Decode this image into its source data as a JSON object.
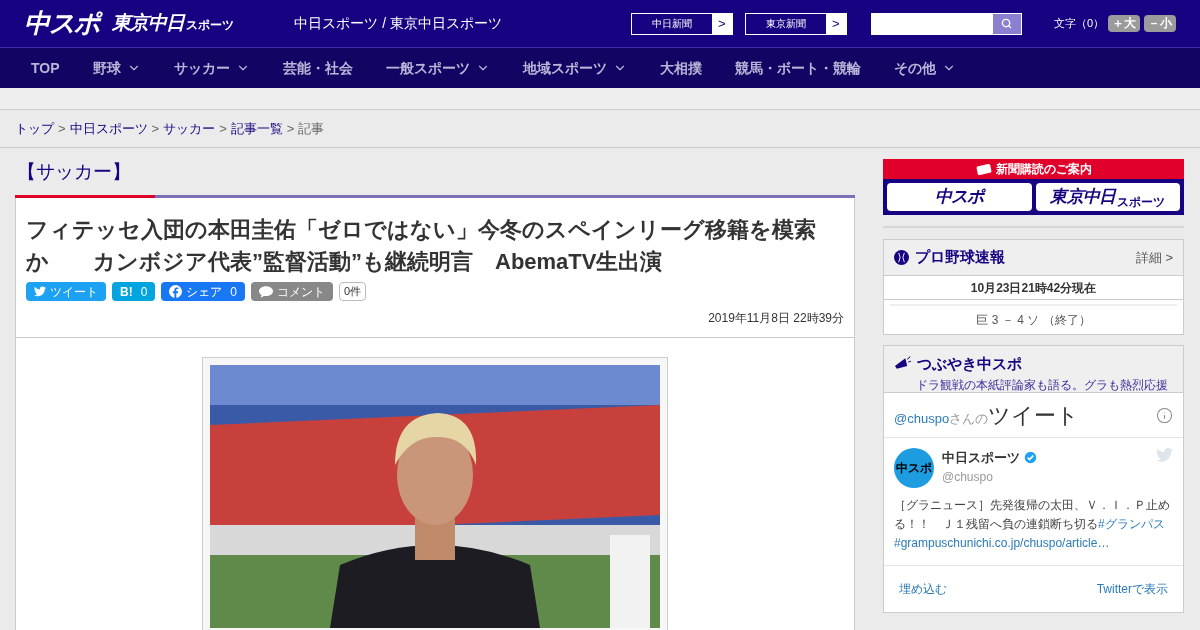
{
  "header": {
    "logo_main": "中スポ",
    "logo_tokyo": "東京中日",
    "logo_tokyo_small": "スポーツ",
    "site_title": "中日スポーツ / 東京中日スポーツ",
    "paper_links": [
      {
        "label": "中日新聞",
        "arrow": ">"
      },
      {
        "label": "東京新聞",
        "arrow": ">"
      }
    ],
    "font_size": {
      "label": "文字（0）",
      "buttons": [
        "＋大",
        "－小"
      ]
    }
  },
  "nav": [
    {
      "label": "TOP",
      "has_menu": false
    },
    {
      "label": "野球",
      "has_menu": true
    },
    {
      "label": "サッカー",
      "has_menu": true
    },
    {
      "label": "芸能・社会",
      "has_menu": false
    },
    {
      "label": "一般スポーツ",
      "has_menu": true
    },
    {
      "label": "地域スポーツ",
      "has_menu": true
    },
    {
      "label": "大相撲",
      "has_menu": false
    },
    {
      "label": "競馬・ボート・競輪",
      "has_menu": false
    },
    {
      "label": "その他",
      "has_menu": true
    }
  ],
  "breadcrumb": {
    "separator": ">",
    "items": [
      {
        "label": "トップ",
        "link": true
      },
      {
        "label": "中日スポーツ",
        "link": true
      },
      {
        "label": "サッカー",
        "link": true
      },
      {
        "label": "記事一覧",
        "link": true
      },
      {
        "label": "記事",
        "link": false
      }
    ]
  },
  "article": {
    "category": "【サッカー】",
    "title": "フィテッセ入団の本田圭佑「ゼロではない」今冬のスペインリーグ移籍を模索か　　カンボジア代表”監督活動”も継続明言　AbemaTV生出演",
    "share": [
      {
        "kind": "twitter",
        "label": "ツイート"
      },
      {
        "kind": "hatena",
        "label": "B!",
        "count": "0"
      },
      {
        "kind": "facebook",
        "label": "シェア",
        "count": "0"
      },
      {
        "kind": "comment",
        "label": "コメント"
      }
    ],
    "comment_count": "0件",
    "date": "2019年11月8日 22時39分"
  },
  "sidebar": {
    "subscribe": {
      "title": "新聞購読のご案内",
      "logos": [
        {
          "kind": "chuspo",
          "text": "中スポ"
        },
        {
          "kind": "tokyo",
          "text": "東京中日",
          "small": "スポーツ"
        }
      ]
    },
    "baseball": {
      "title": "プロ野球速報",
      "detail": "詳細 >",
      "updated": "10月23日21時42分現在",
      "score": "巨 3 － 4 ソ （終了）"
    },
    "tweets": {
      "title": "つぶやき中スポ",
      "subtitle": "ドラ観戦の本紙評論家も語る。グラも熱烈応援",
      "account": "@chuspo",
      "account_suffix": "さんの",
      "heading": "ツイート",
      "tweet": {
        "avatar": "中スポ",
        "name": "中日スポーツ",
        "verified": true,
        "handle": "@chuspo",
        "text": "［グラニュース］先発復帰の太田、Ｖ．Ｉ．Ｐ止める！！　Ｊ１残留へ負の連鎖断ち切る",
        "hashtag": "#グランパス",
        "link": "#grampuschunichi.co.jp/chuspo/article…"
      },
      "embed": "埋め込む",
      "view": "Twitterで表示"
    }
  }
}
